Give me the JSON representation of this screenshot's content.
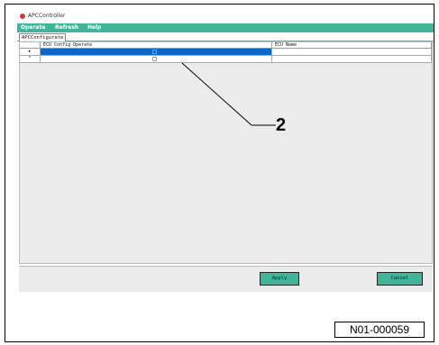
{
  "window": {
    "title": "APCController",
    "menu": [
      "Operate",
      "Refresh",
      "Help"
    ],
    "tab_label": "APCConfigurate"
  },
  "grid": {
    "columns": [
      "ECU Config Operate",
      "ECU Name"
    ],
    "rows": [
      {
        "marker": "▸",
        "selected": true,
        "ecu_name": ""
      },
      {
        "marker": "*",
        "selected": false,
        "ecu_name": ""
      }
    ]
  },
  "buttons": {
    "apply": "Apply",
    "cancel": "Cancel"
  },
  "annotation": {
    "callout": "2",
    "figure_ref": "N01-000059"
  },
  "colors": {
    "menubar": "#3fb59a",
    "selection": "#0a66c9",
    "button": "#3fb59a"
  }
}
